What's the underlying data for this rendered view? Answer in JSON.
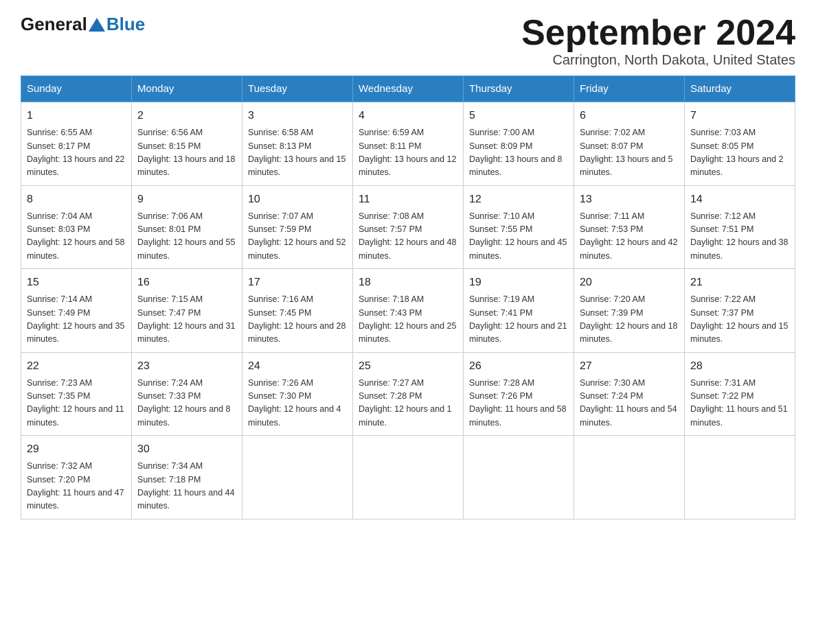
{
  "header": {
    "title": "September 2024",
    "location": "Carrington, North Dakota, United States",
    "logo_general": "General",
    "logo_blue": "Blue"
  },
  "weekdays": [
    "Sunday",
    "Monday",
    "Tuesday",
    "Wednesday",
    "Thursday",
    "Friday",
    "Saturday"
  ],
  "weeks": [
    [
      {
        "day": "1",
        "sunrise": "6:55 AM",
        "sunset": "8:17 PM",
        "daylight": "13 hours and 22 minutes."
      },
      {
        "day": "2",
        "sunrise": "6:56 AM",
        "sunset": "8:15 PM",
        "daylight": "13 hours and 18 minutes."
      },
      {
        "day": "3",
        "sunrise": "6:58 AM",
        "sunset": "8:13 PM",
        "daylight": "13 hours and 15 minutes."
      },
      {
        "day": "4",
        "sunrise": "6:59 AM",
        "sunset": "8:11 PM",
        "daylight": "13 hours and 12 minutes."
      },
      {
        "day": "5",
        "sunrise": "7:00 AM",
        "sunset": "8:09 PM",
        "daylight": "13 hours and 8 minutes."
      },
      {
        "day": "6",
        "sunrise": "7:02 AM",
        "sunset": "8:07 PM",
        "daylight": "13 hours and 5 minutes."
      },
      {
        "day": "7",
        "sunrise": "7:03 AM",
        "sunset": "8:05 PM",
        "daylight": "13 hours and 2 minutes."
      }
    ],
    [
      {
        "day": "8",
        "sunrise": "7:04 AM",
        "sunset": "8:03 PM",
        "daylight": "12 hours and 58 minutes."
      },
      {
        "day": "9",
        "sunrise": "7:06 AM",
        "sunset": "8:01 PM",
        "daylight": "12 hours and 55 minutes."
      },
      {
        "day": "10",
        "sunrise": "7:07 AM",
        "sunset": "7:59 PM",
        "daylight": "12 hours and 52 minutes."
      },
      {
        "day": "11",
        "sunrise": "7:08 AM",
        "sunset": "7:57 PM",
        "daylight": "12 hours and 48 minutes."
      },
      {
        "day": "12",
        "sunrise": "7:10 AM",
        "sunset": "7:55 PM",
        "daylight": "12 hours and 45 minutes."
      },
      {
        "day": "13",
        "sunrise": "7:11 AM",
        "sunset": "7:53 PM",
        "daylight": "12 hours and 42 minutes."
      },
      {
        "day": "14",
        "sunrise": "7:12 AM",
        "sunset": "7:51 PM",
        "daylight": "12 hours and 38 minutes."
      }
    ],
    [
      {
        "day": "15",
        "sunrise": "7:14 AM",
        "sunset": "7:49 PM",
        "daylight": "12 hours and 35 minutes."
      },
      {
        "day": "16",
        "sunrise": "7:15 AM",
        "sunset": "7:47 PM",
        "daylight": "12 hours and 31 minutes."
      },
      {
        "day": "17",
        "sunrise": "7:16 AM",
        "sunset": "7:45 PM",
        "daylight": "12 hours and 28 minutes."
      },
      {
        "day": "18",
        "sunrise": "7:18 AM",
        "sunset": "7:43 PM",
        "daylight": "12 hours and 25 minutes."
      },
      {
        "day": "19",
        "sunrise": "7:19 AM",
        "sunset": "7:41 PM",
        "daylight": "12 hours and 21 minutes."
      },
      {
        "day": "20",
        "sunrise": "7:20 AM",
        "sunset": "7:39 PM",
        "daylight": "12 hours and 18 minutes."
      },
      {
        "day": "21",
        "sunrise": "7:22 AM",
        "sunset": "7:37 PM",
        "daylight": "12 hours and 15 minutes."
      }
    ],
    [
      {
        "day": "22",
        "sunrise": "7:23 AM",
        "sunset": "7:35 PM",
        "daylight": "12 hours and 11 minutes."
      },
      {
        "day": "23",
        "sunrise": "7:24 AM",
        "sunset": "7:33 PM",
        "daylight": "12 hours and 8 minutes."
      },
      {
        "day": "24",
        "sunrise": "7:26 AM",
        "sunset": "7:30 PM",
        "daylight": "12 hours and 4 minutes."
      },
      {
        "day": "25",
        "sunrise": "7:27 AM",
        "sunset": "7:28 PM",
        "daylight": "12 hours and 1 minute."
      },
      {
        "day": "26",
        "sunrise": "7:28 AM",
        "sunset": "7:26 PM",
        "daylight": "11 hours and 58 minutes."
      },
      {
        "day": "27",
        "sunrise": "7:30 AM",
        "sunset": "7:24 PM",
        "daylight": "11 hours and 54 minutes."
      },
      {
        "day": "28",
        "sunrise": "7:31 AM",
        "sunset": "7:22 PM",
        "daylight": "11 hours and 51 minutes."
      }
    ],
    [
      {
        "day": "29",
        "sunrise": "7:32 AM",
        "sunset": "7:20 PM",
        "daylight": "11 hours and 47 minutes."
      },
      {
        "day": "30",
        "sunrise": "7:34 AM",
        "sunset": "7:18 PM",
        "daylight": "11 hours and 44 minutes."
      },
      null,
      null,
      null,
      null,
      null
    ]
  ]
}
